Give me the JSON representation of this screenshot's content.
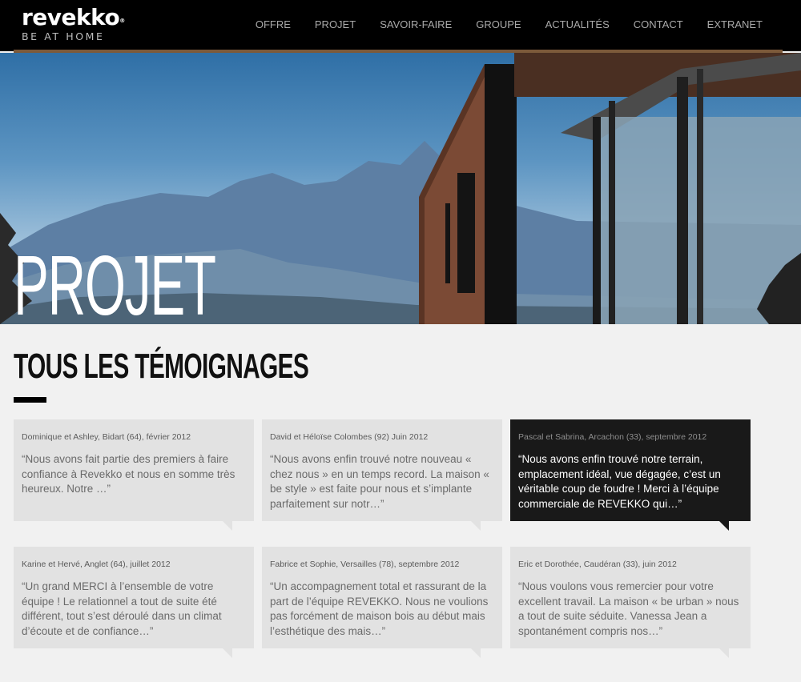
{
  "brand": {
    "name": "revekko",
    "registered": "®",
    "tagline": "BE AT HOME"
  },
  "nav": {
    "items": [
      {
        "label": "OFFRE"
      },
      {
        "label": "PROJET"
      },
      {
        "label": "SAVOIR-FAIRE"
      },
      {
        "label": "GROUPE"
      },
      {
        "label": "ACTUALITÉS"
      },
      {
        "label": "CONTACT"
      },
      {
        "label": "EXTRANET"
      }
    ]
  },
  "hero": {
    "title": "PROJET"
  },
  "section": {
    "title": "TOUS LES TÉMOIGNAGES"
  },
  "testimonials": [
    {
      "meta": "Dominique et Ashley, Bidart (64), février 2012",
      "quote": "“Nous avons fait partie des premiers à faire confiance à Revekko et nous en somme très heureux. Notre …”"
    },
    {
      "meta": "David et Héloïse Colombes (92) Juin 2012",
      "quote": "“Nous avons enfin trouvé notre nouveau « chez nous » en un temps record. La maison « be style » est faite pour nous et s’implante parfaitement sur notr…”"
    },
    {
      "meta": "Pascal et Sabrina, Arcachon (33), septembre 2012",
      "quote": "“Nous avons enfin trouvé notre terrain, emplacement idéal, vue dégagée, c’est un véritable coup de foudre ! Merci à l’équipe commerciale de REVEKKO qui…”"
    },
    {
      "meta": "Karine et Hervé, Anglet (64), juillet 2012",
      "quote": "“Un grand MERCI à l’ensemble de votre équipe ! Le relationnel a tout de suite été différent, tout s’est déroulé dans un climat d’écoute et de confiance…”"
    },
    {
      "meta": "Fabrice et Sophie, Versailles (78), septembre 2012",
      "quote": "“Un accompagnement total et rassurant de la part de l’équipe REVEKKO. Nous ne voulions pas forcément de maison bois au début mais l’esthétique des mais…”"
    },
    {
      "meta": "Eric et Dorothée, Caudéran (33), juin 2012",
      "quote": "“Nous voulons vous remercier pour votre excellent travail. La maison « be urban » nous a tout de suite séduite. Vanessa Jean a spontanément compris nos…”"
    }
  ],
  "colors": {
    "header_bg": "#000000",
    "accent_rule": "#7c5a3a",
    "card_bg": "#e2e2e2",
    "card_active_bg": "#191919",
    "page_bg": "#f1f1f1"
  }
}
